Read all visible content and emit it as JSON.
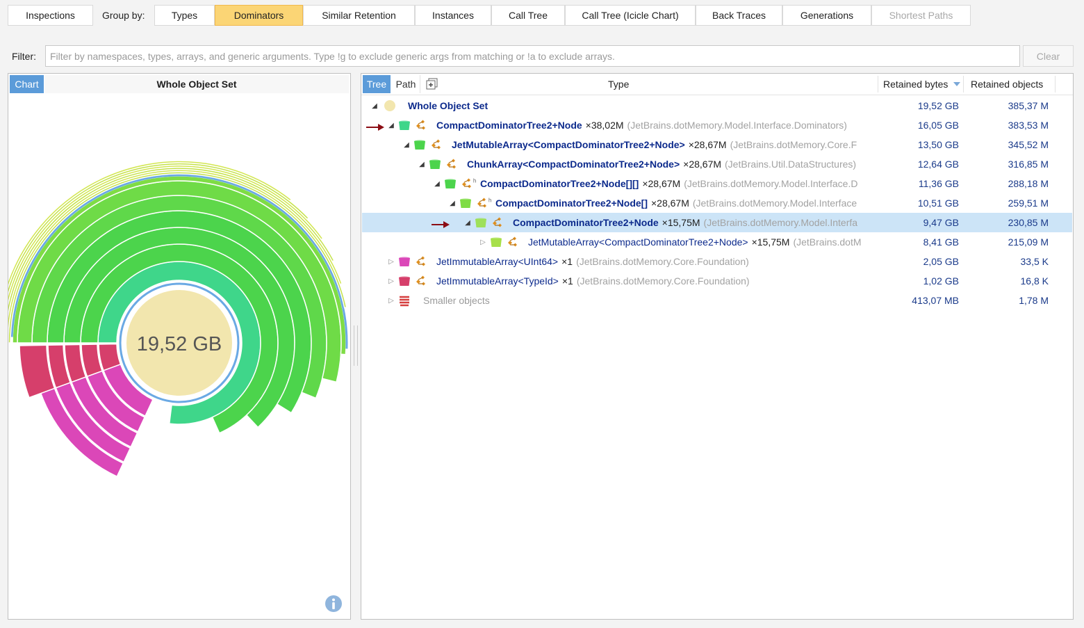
{
  "toolbar": {
    "inspections": "Inspections",
    "group_by": "Group by:",
    "tabs": [
      "Types",
      "Dominators",
      "Similar Retention",
      "Instances",
      "Call Tree",
      "Call Tree (Icicle Chart)",
      "Back Traces",
      "Generations",
      "Shortest Paths"
    ],
    "active_tab": "Dominators",
    "disabled_tab": "Shortest Paths"
  },
  "filter": {
    "label": "Filter:",
    "placeholder": "Filter by namespaces, types, arrays, and generic arguments. Type !g to exclude generic args from matching or !a to exclude arrays.",
    "value": "",
    "clear_label": "Clear"
  },
  "chart_panel": {
    "tab": "Chart",
    "title": "Whole Object Set",
    "center_value": "19,52 GB",
    "colors": {
      "green": "#4cd44c",
      "lime": "#7fdc45",
      "teal": "#3fd68a",
      "yellow": "#d2e650",
      "pink": "#db47b8",
      "red": "#d63f6b",
      "center": "#f2e6ae",
      "ring": "#6aa9e4"
    }
  },
  "tree_panel": {
    "tabs": {
      "tree": "Tree",
      "path": "Path"
    },
    "columns": {
      "type": "Type",
      "bytes": "Retained bytes",
      "objects": "Retained objects"
    },
    "rows": [
      {
        "name": "Whole Object Set",
        "count": "",
        "ns": "",
        "bytes": "19,52 GB",
        "objects": "385,37 M"
      },
      {
        "name": "CompactDominatorTree2+Node",
        "count": "×38,02M",
        "ns": "(JetBrains.dotMemory.Model.Interface.Dominators)",
        "bytes": "16,05 GB",
        "objects": "383,53 M"
      },
      {
        "name": "JetMutableArray<CompactDominatorTree2+Node>",
        "count": "×28,67M",
        "ns": "(JetBrains.dotMemory.Core.F",
        "bytes": "13,50 GB",
        "objects": "345,52 M"
      },
      {
        "name": "ChunkArray<CompactDominatorTree2+Node>",
        "count": "×28,67M",
        "ns": "(JetBrains.Util.DataStructures)",
        "bytes": "12,64 GB",
        "objects": "316,85 M"
      },
      {
        "name": "CompactDominatorTree2+Node[][]",
        "count": "×28,67M",
        "ns": "(JetBrains.dotMemory.Model.Interface.D",
        "bytes": "11,36 GB",
        "objects": "288,18 M"
      },
      {
        "name": "CompactDominatorTree2+Node[]",
        "count": "×28,67M",
        "ns": "(JetBrains.dotMemory.Model.Interface",
        "bytes": "10,51 GB",
        "objects": "259,51 M"
      },
      {
        "name": "CompactDominatorTree2+Node",
        "count": "×15,75M",
        "ns": "(JetBrains.dotMemory.Model.Interfa",
        "bytes": "9,47 GB",
        "objects": "230,85 M"
      },
      {
        "name": "JetMutableArray<CompactDominatorTree2+Node>",
        "count": "×15,75M",
        "ns": "(JetBrains.dotM",
        "bytes": "8,41 GB",
        "objects": "215,09 M"
      },
      {
        "name": "JetImmutableArray<UInt64>",
        "count": "×1",
        "ns": "(JetBrains.dotMemory.Core.Foundation)",
        "bytes": "2,05 GB",
        "objects": "33,5 K"
      },
      {
        "name": "JetImmutableArray<TypeId>",
        "count": "×1",
        "ns": "(JetBrains.dotMemory.Core.Foundation)",
        "bytes": "1,02 GB",
        "objects": "16,8 K"
      },
      {
        "name": "Smaller objects",
        "count": "",
        "ns": "",
        "bytes": "413,07 MB",
        "objects": "1,78 M"
      }
    ]
  }
}
